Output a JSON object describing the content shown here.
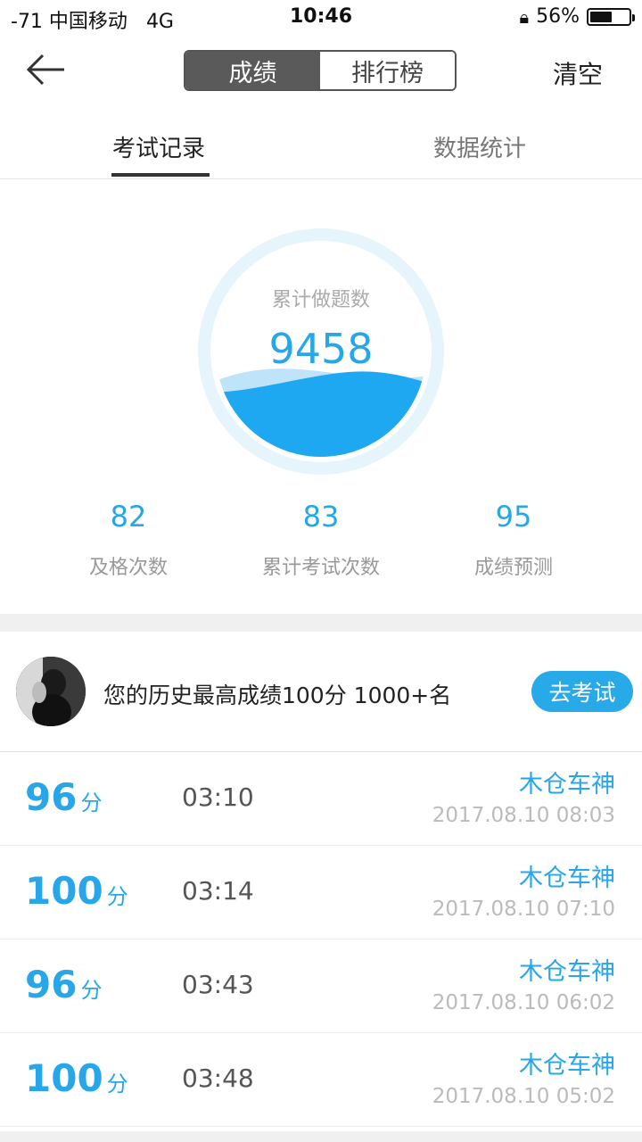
{
  "status": {
    "signal": "-71 中国移动",
    "network": "4G",
    "time": "10:46",
    "battery_text": "56%",
    "battery_level": 0.56
  },
  "nav": {
    "seg_left": "成绩",
    "seg_right": "排行榜",
    "clear": "清空"
  },
  "tabs": {
    "records": "考试记录",
    "stats": "数据统计"
  },
  "gauge": {
    "label": "累计做题数",
    "value": "9458"
  },
  "stats": [
    {
      "value": "82",
      "label": "及格次数"
    },
    {
      "value": "83",
      "label": "累计考试次数"
    },
    {
      "value": "95",
      "label": "成绩预测"
    }
  ],
  "best": {
    "text": "您的历史最高成绩100分  1000+名",
    "button": "去考试"
  },
  "records": [
    {
      "score": "96",
      "unit": "分",
      "duration": "03:10",
      "title": "木仓车神",
      "time": "2017.08.10 08:03"
    },
    {
      "score": "100",
      "unit": "分",
      "duration": "03:14",
      "title": "木仓车神",
      "time": "2017.08.10 07:10"
    },
    {
      "score": "96",
      "unit": "分",
      "duration": "03:43",
      "title": "木仓车神",
      "time": "2017.08.10 06:02"
    },
    {
      "score": "100",
      "unit": "分",
      "duration": "03:48",
      "title": "木仓车神",
      "time": "2017.08.10 05:02"
    }
  ],
  "colors": {
    "accent": "#27a6ea",
    "segment_active": "#5a5a5a"
  }
}
